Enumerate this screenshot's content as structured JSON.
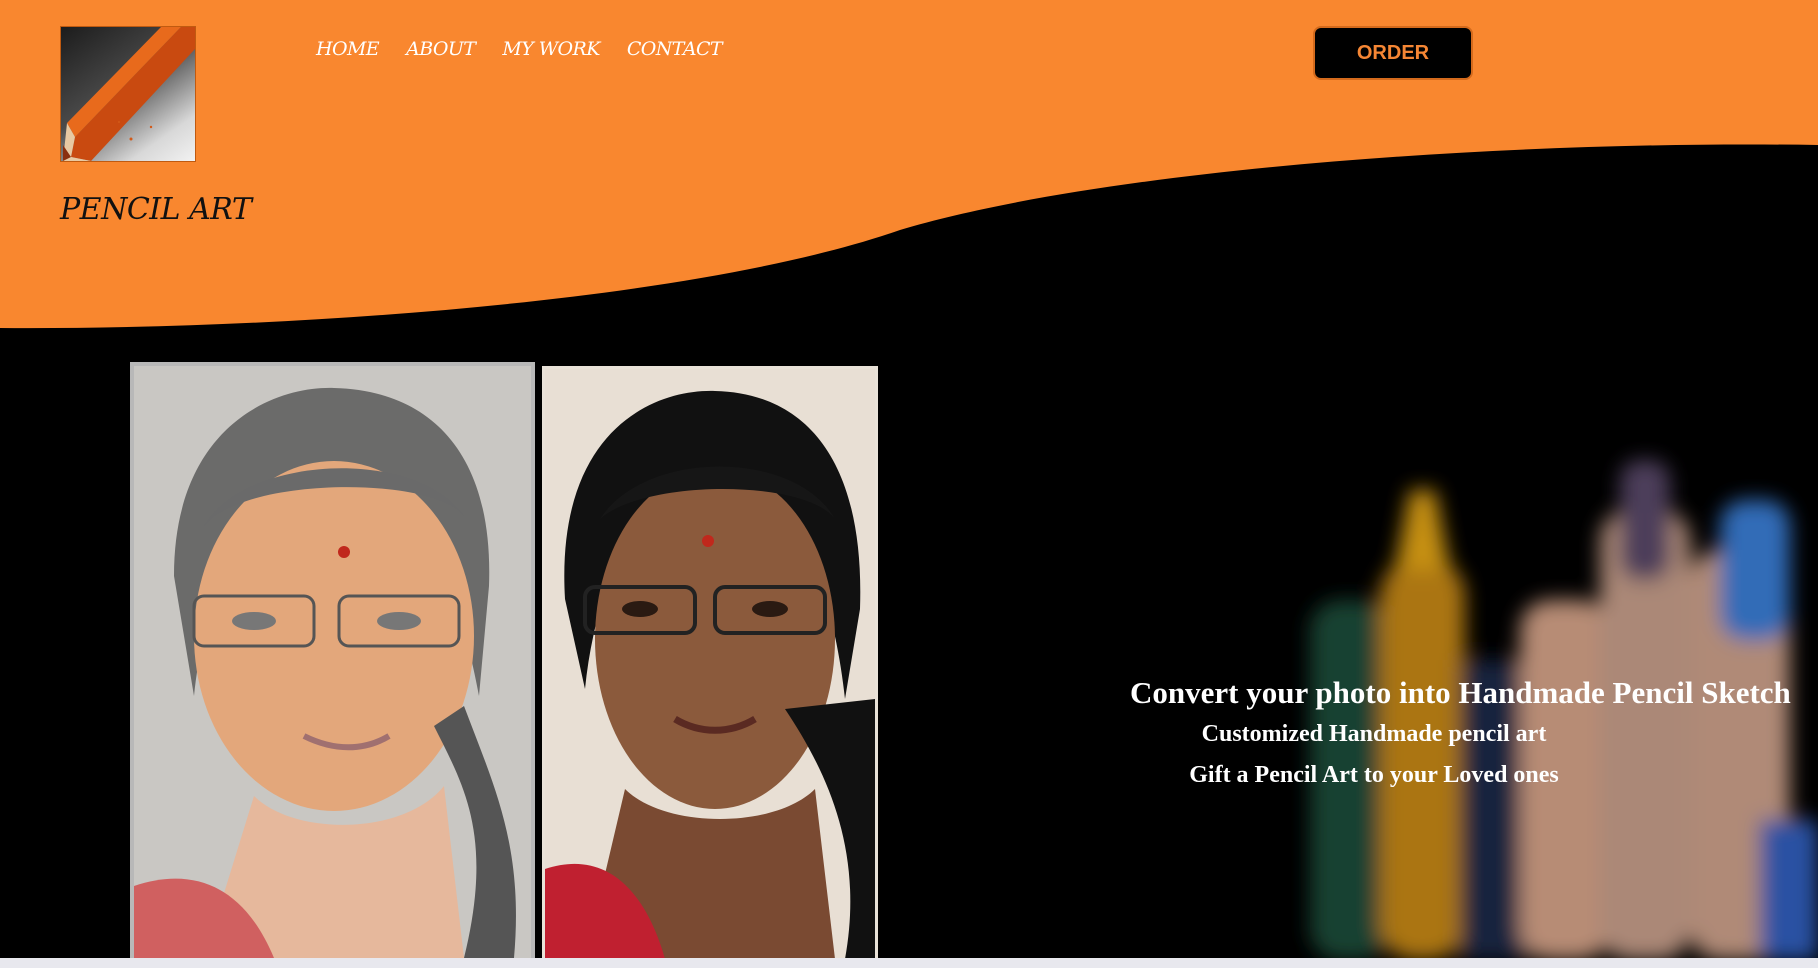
{
  "brand": {
    "name": "PENCIL ART",
    "logo_icon": "pencil-tip-icon"
  },
  "nav": {
    "items": [
      "HOME",
      "ABOUT",
      "MY WORK",
      "CONTACT"
    ]
  },
  "order_button": {
    "label": "ORDER"
  },
  "hero": {
    "line1": "Convert your photo into Handmade Pencil Sketch",
    "line2": "Customized Handmade pencil art",
    "line3": "Gift a Pencil Art to your Loved ones"
  },
  "colors": {
    "accent": "#f9872f",
    "background": "#000000",
    "button_text": "#f58634"
  }
}
